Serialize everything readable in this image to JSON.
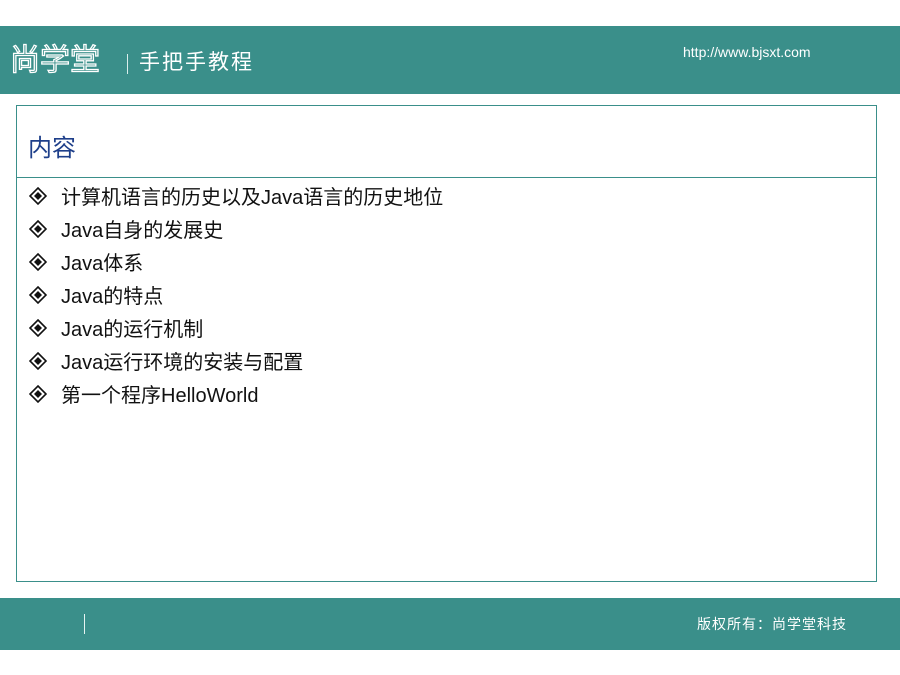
{
  "header": {
    "logo_text": "尚学堂",
    "subtitle": "手把手教程",
    "url": "http://www.bjsxt.com"
  },
  "content": {
    "title": "内容",
    "bullet_icon": "diamond-bullet-icon",
    "items": [
      "计算机语言的历史以及Java语言的历史地位",
      "Java自身的发展史",
      "Java体系",
      "Java的特点",
      "Java的运行机制",
      "Java运行环境的安装与配置",
      "第一个程序HelloWorld"
    ]
  },
  "footer": {
    "copyright": "版权所有：尚学堂科技"
  },
  "colors": {
    "teal": "#3a8f8a",
    "title_blue": "#1e3f8a"
  }
}
